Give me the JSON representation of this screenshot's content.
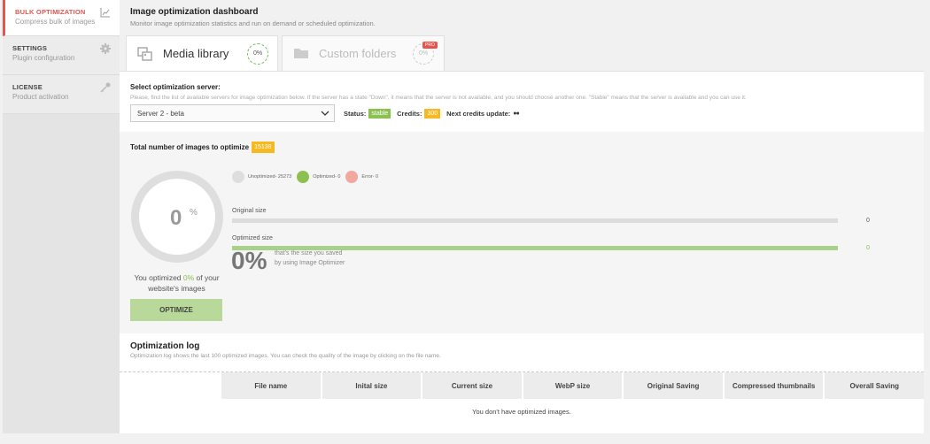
{
  "sidebar": {
    "items": [
      {
        "title": "BULK OPTIMIZATION",
        "sub": "Compress bulk of images",
        "icon": "chart-icon"
      },
      {
        "title": "SETTINGS",
        "sub": "Plugin configuration",
        "icon": "gear-icon"
      },
      {
        "title": "LICENSE",
        "sub": "Product activation",
        "icon": "key-icon"
      }
    ]
  },
  "header": {
    "title": "Image optimization dashboard",
    "subtitle": "Monitor image optimization statistics and run on demand or scheduled optimization."
  },
  "tabs": [
    {
      "label": "Media library",
      "percent": "0%"
    },
    {
      "label": "Custom folders",
      "percent": "0%",
      "badge": "PRO"
    }
  ],
  "server": {
    "title": "Select optimization server:",
    "note": "Please, find the list of available servers for image optimization below. If the server has a state \"Down\", it means that the server is not available, and you should choose another one. \"Stable\" means that the server is available and you can use it.",
    "selected": "Server 2 - beta",
    "status_label": "Status:",
    "status_value": "stable",
    "credits_label": "Credits:",
    "credits_value": "300",
    "next_label": "Next credits update:",
    "next_value": "●●"
  },
  "totals": {
    "title": "Total number of images to optimize",
    "count": "15138",
    "percent": "0",
    "percent_sign": "%",
    "you_optimized_pre": "You optimized ",
    "you_optimized_value": "0%",
    "you_optimized_post": " of your website's images",
    "optimize_button": "OPTIMIZE",
    "legend": [
      {
        "label": "Unoptimized- 25273",
        "color": "#dedede"
      },
      {
        "label": "Optimized- 0",
        "color": "#8cc152"
      },
      {
        "label": "Error- 0",
        "color": "#f2a89e"
      }
    ],
    "original_size_label": "Original size",
    "original_size_value": "0",
    "optimized_size_label": "Optimized size",
    "optimized_size_value": "0",
    "saved_percent": "0%",
    "saved_text_1": "that's the size you saved",
    "saved_text_2": "by using Image Optimizer"
  },
  "log": {
    "title": "Optimization log",
    "subtitle": "Optimization log shows the last 100 optimized images. You can check the quality of the image by clicking on the file name.",
    "columns": [
      "File name",
      "Inital size",
      "Current size",
      "WebP size",
      "Original Saving",
      "Compressed thumbnails",
      "Overall Saving"
    ],
    "empty": "You don't have optimized images."
  },
  "colors": {
    "accent": "#e5554e",
    "green": "#8cc152",
    "yellow": "#f5b921"
  }
}
